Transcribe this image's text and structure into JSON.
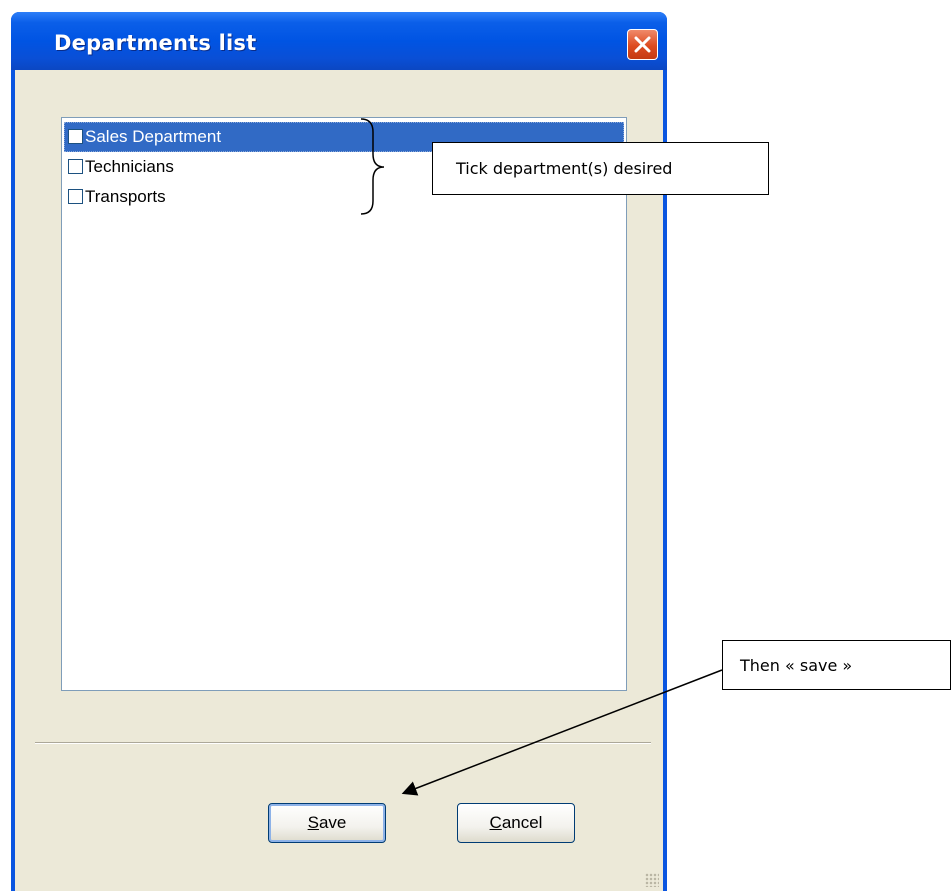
{
  "window": {
    "title": "Departments list",
    "close_icon": "close-icon"
  },
  "departments": [
    {
      "label": "Sales Department",
      "checked": false,
      "selected": true
    },
    {
      "label": "Technicians",
      "checked": false,
      "selected": false
    },
    {
      "label": "Transports",
      "checked": false,
      "selected": false
    }
  ],
  "buttons": {
    "save": {
      "accel": "S",
      "rest": "ave"
    },
    "cancel": {
      "accel": "C",
      "rest": "ancel"
    }
  },
  "annotations": {
    "tick_note": "Tick department(s) desired",
    "save_note": "Then « save »"
  },
  "colors": {
    "titlebar": "#0054e3",
    "selection": "#316ac5",
    "dialog_face": "#ece9d8"
  }
}
